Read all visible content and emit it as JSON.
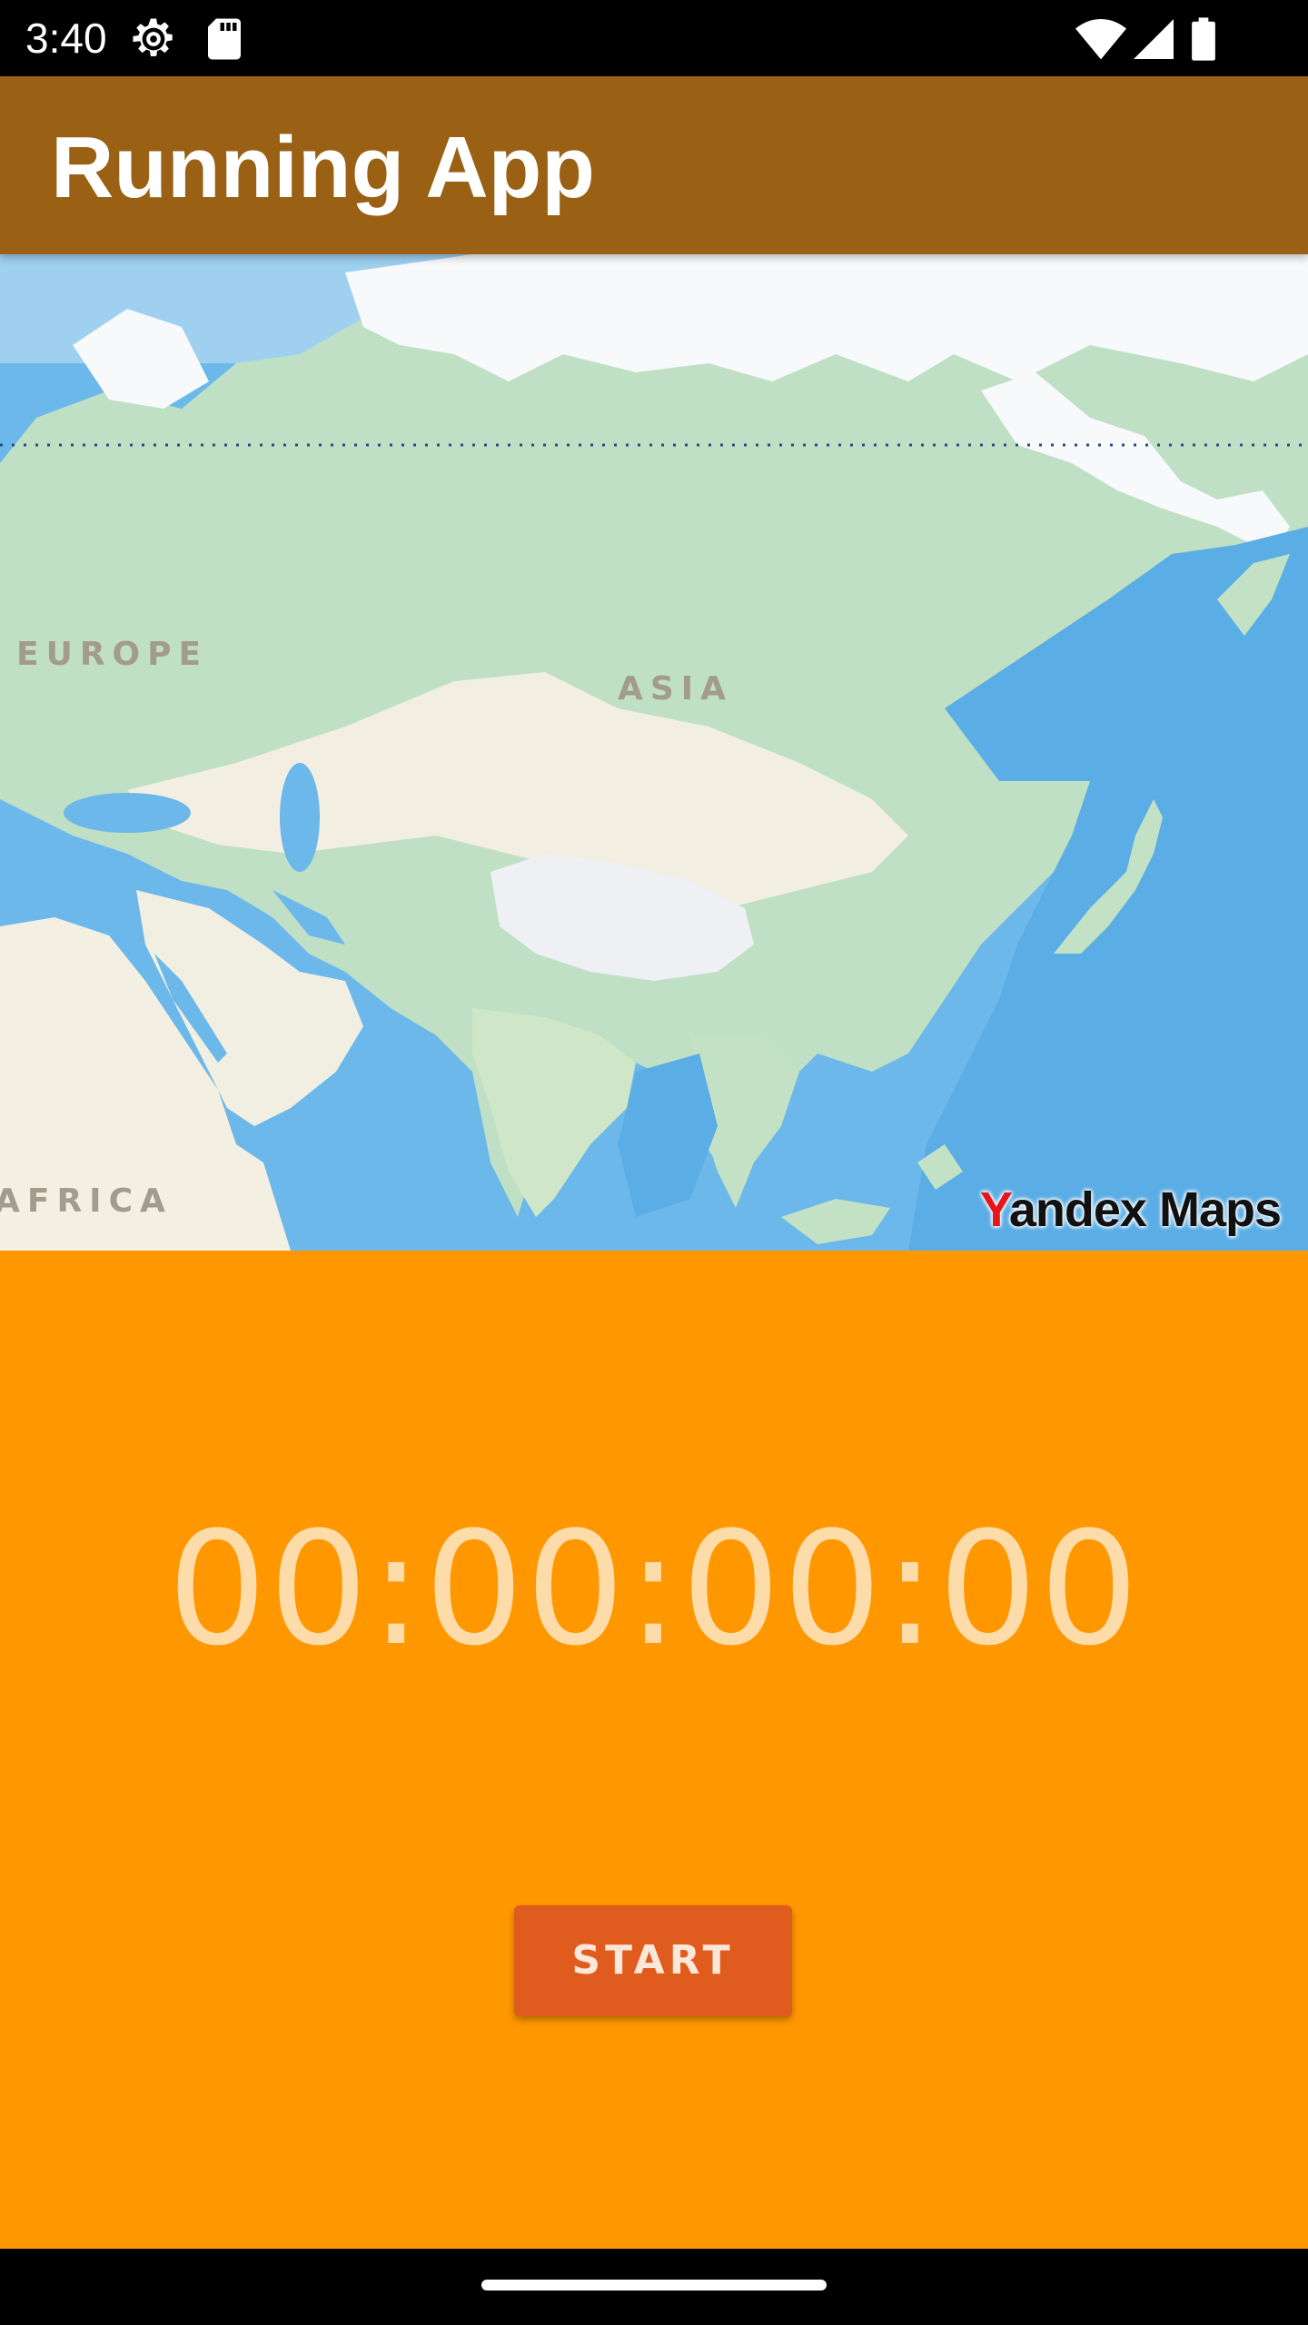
{
  "status_bar": {
    "time": "3:40",
    "icons": [
      "gear-icon",
      "sd-card-icon",
      "wifi-icon",
      "cell-signal-icon",
      "battery-icon"
    ]
  },
  "app_bar": {
    "title": "Running App",
    "color": "#9a6115"
  },
  "map": {
    "labels": {
      "europe": "EUROPE",
      "asia": "ASIA",
      "africa": "AFRICA"
    },
    "attribution_y": "Y",
    "attribution_rest": "andex Maps"
  },
  "timer": {
    "value": "00:00:00:00"
  },
  "controls": {
    "start_label": "START"
  },
  "colors": {
    "background": "#ff9800",
    "button": "#e05b1e",
    "timer_text": "#fddcaa"
  }
}
